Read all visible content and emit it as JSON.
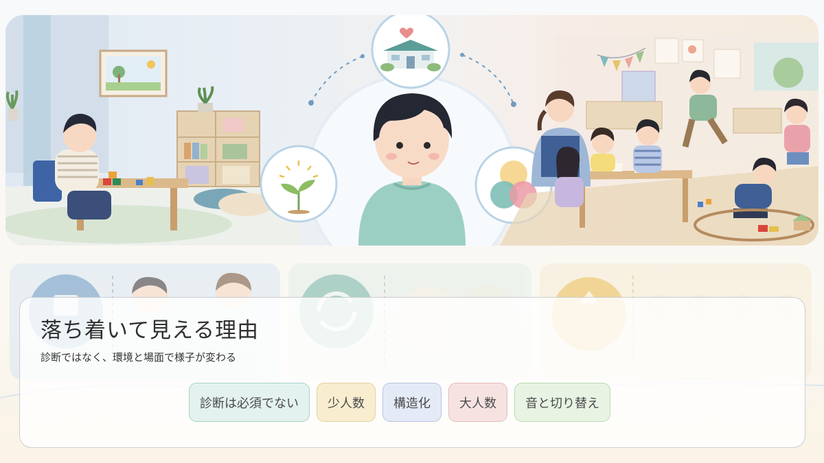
{
  "panel": {
    "title": "落ち着いて見える理由",
    "subtitle": "診断ではなく、環境と場面で様子が変わる"
  },
  "tags": [
    {
      "label": "診断は必須でない",
      "bg": "#e3f2ef",
      "border": "#a8cfc6"
    },
    {
      "label": "少人数",
      "bg": "#f8edcf",
      "border": "#e2cf9c"
    },
    {
      "label": "構造化",
      "bg": "#e5eaf7",
      "border": "#b7c3e2"
    },
    {
      "label": "大人数",
      "bg": "#f6e3e1",
      "border": "#e1bcb8"
    },
    {
      "label": "音と切り替え",
      "bg": "#e8f3e3",
      "border": "#bcd9b0"
    }
  ],
  "colors": {
    "hero_left": "#dfe8f2",
    "hero_right": "#f5ebdd",
    "icon_ring": "#b9d3e6",
    "card_blue": "#d9e6f2",
    "card_green": "#e3eee9",
    "card_yellow": "#f8ecd6"
  },
  "icons": [
    "house-heart-icon",
    "sprout-icon",
    "color-circles-icon",
    "rotate-arrows-icon",
    "shapes-icon"
  ]
}
